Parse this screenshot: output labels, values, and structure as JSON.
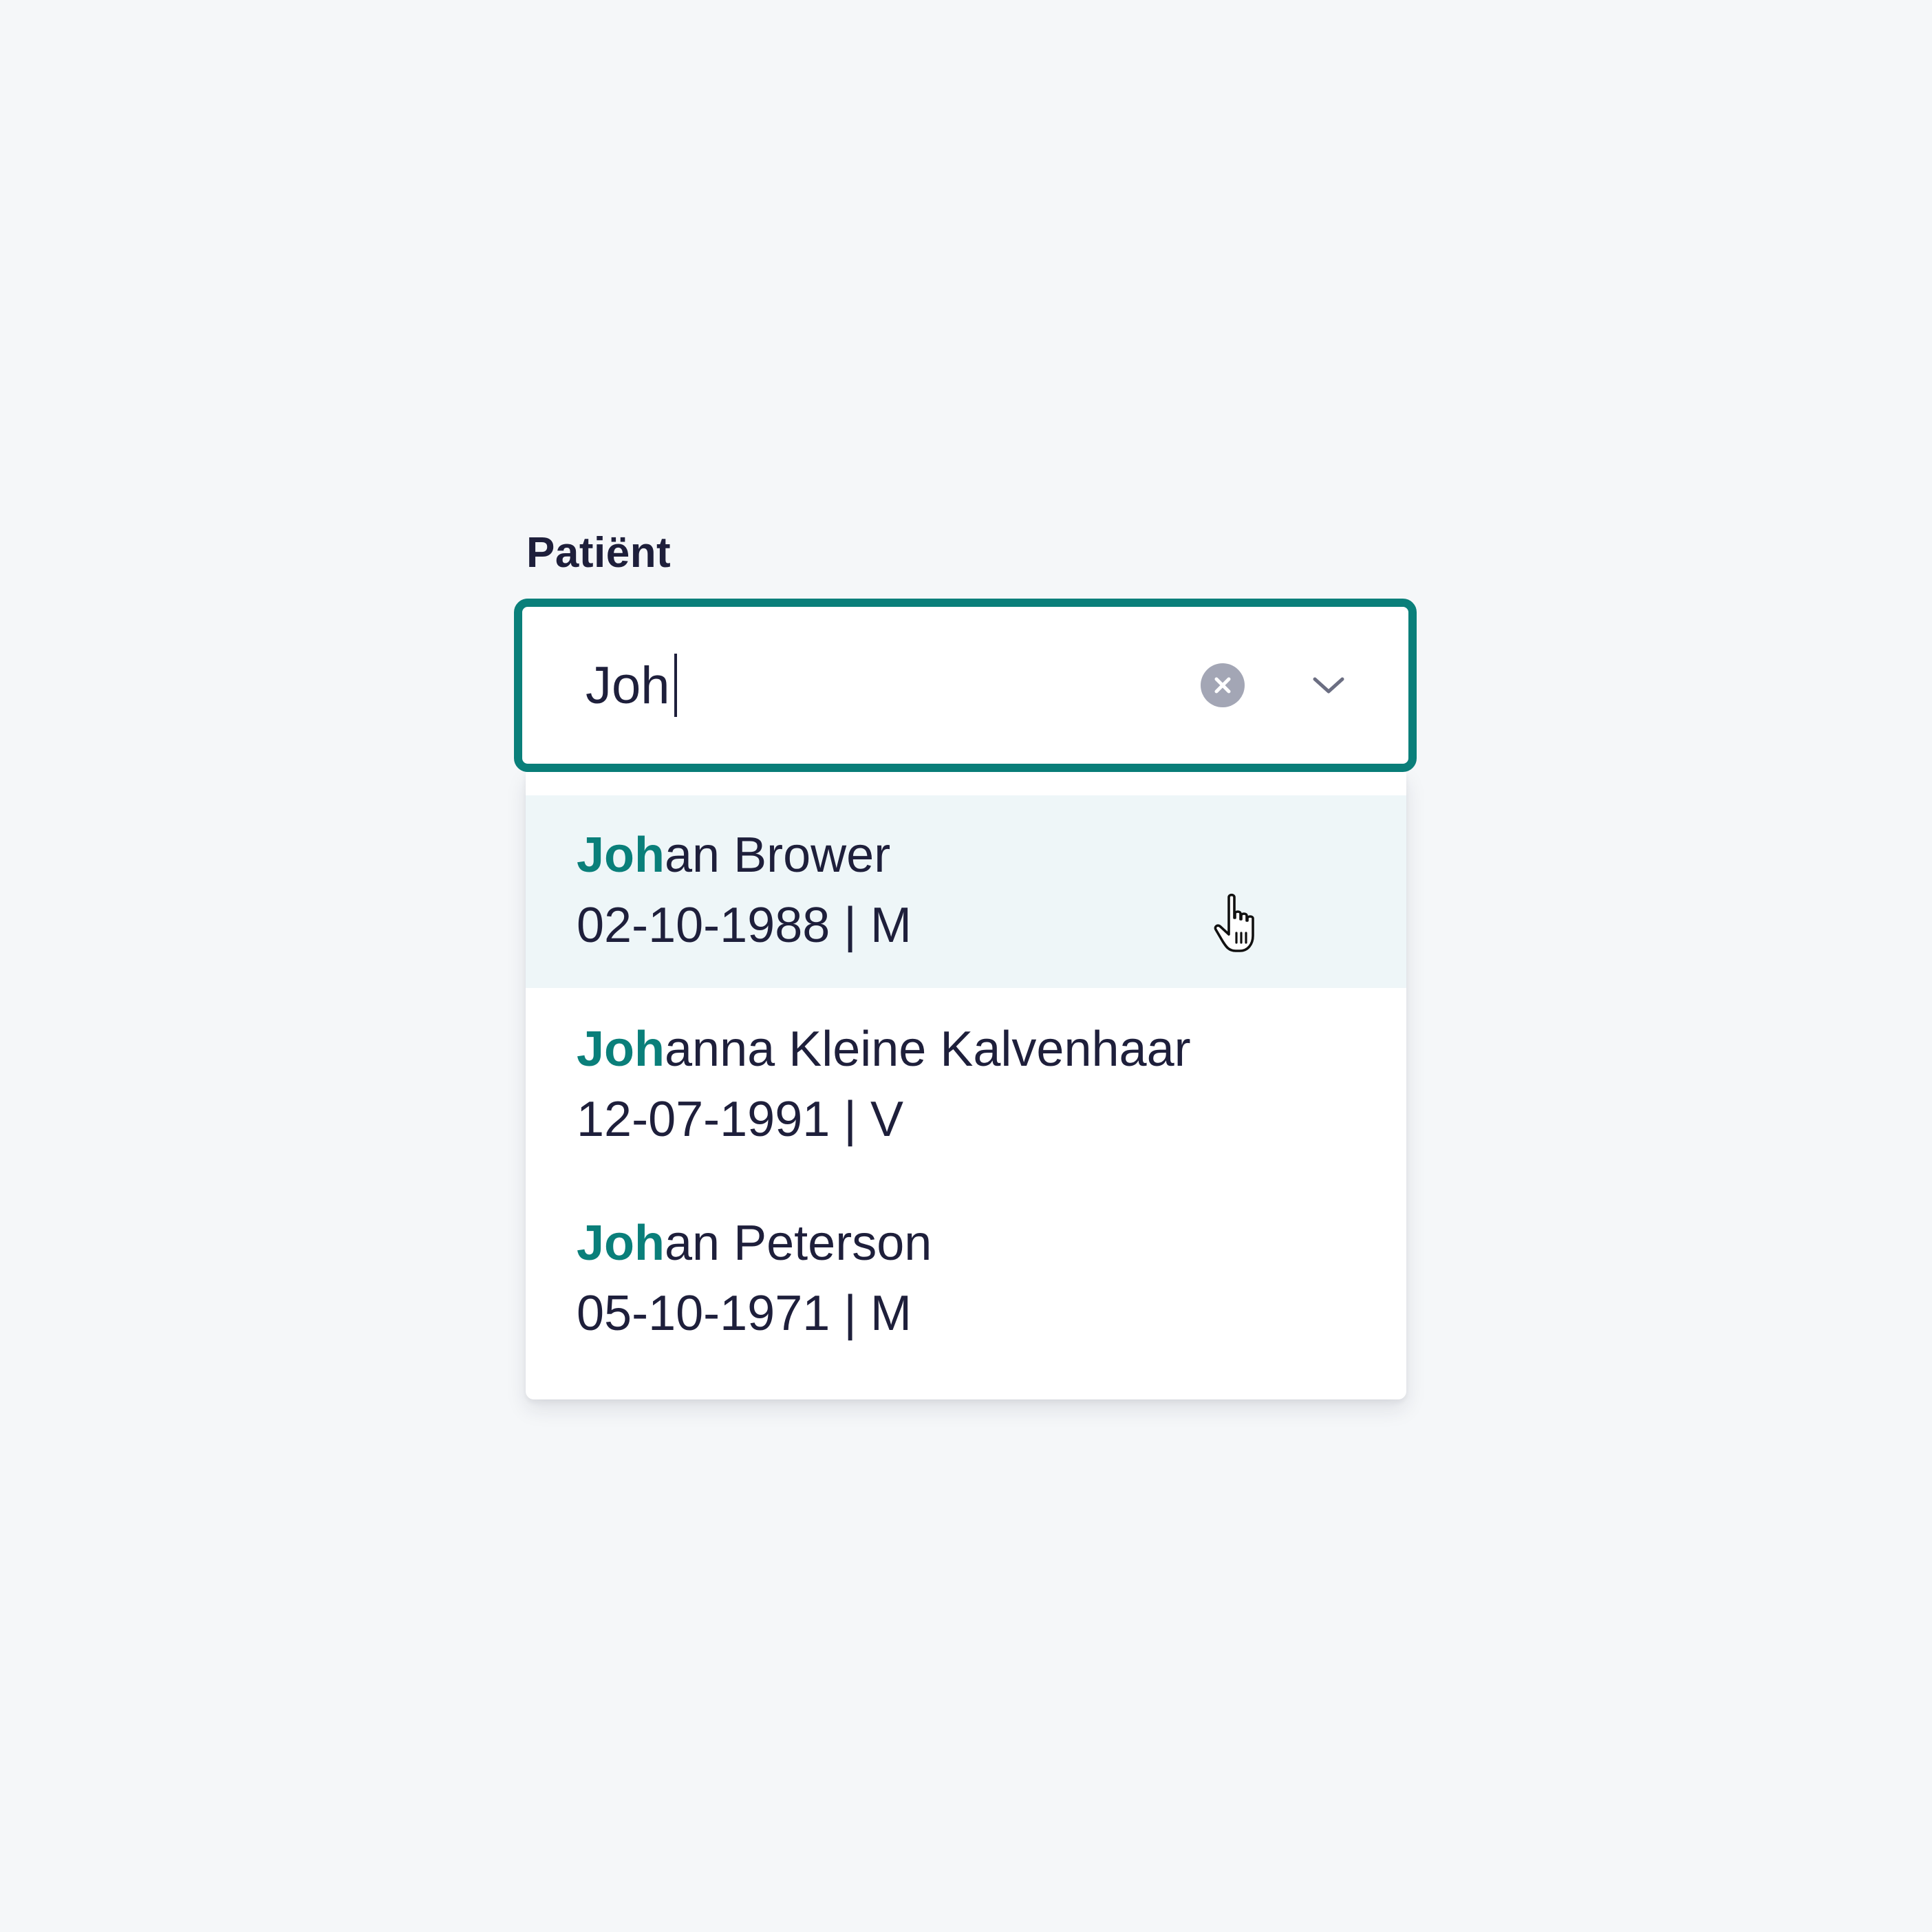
{
  "field": {
    "label": "Patiënt"
  },
  "combobox": {
    "value": "Joh",
    "clear_icon": "clear-circle-icon",
    "toggle_icon": "chevron-down-icon"
  },
  "options": [
    {
      "match": "Joh",
      "rest": "an Brower",
      "meta": "02-10-1988 | M",
      "highlighted": true
    },
    {
      "match": "Joh",
      "rest": "anna Kleine Kalvenhaar",
      "meta": "12-07-1991 | V",
      "highlighted": false
    },
    {
      "match": "Joh",
      "rest": "an Peterson",
      "meta": "05-10-1971 | M",
      "highlighted": false
    }
  ],
  "colors": {
    "accent": "#0a7f7a",
    "text": "#1e1f3b",
    "highlight_bg": "#eef6f8",
    "clear_icon": "#a3a6b5",
    "page_bg": "#f5f7f9"
  },
  "pointer_icon": "hand-pointer-icon"
}
